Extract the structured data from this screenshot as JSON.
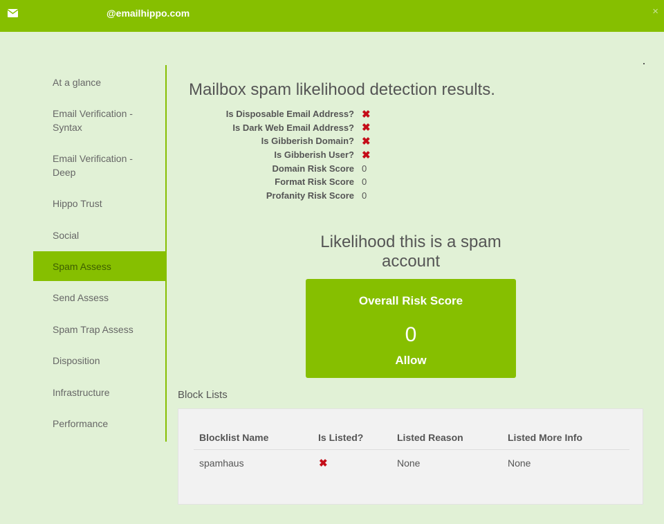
{
  "header": {
    "email": "@emailhippo.com",
    "mail_icon": "envelope-icon",
    "close_label": "×",
    "bg_color": "#86bf00"
  },
  "sidebar": {
    "items": [
      {
        "label": "At a glance",
        "active": false
      },
      {
        "label": "Email Verification - Syntax",
        "active": false
      },
      {
        "label": "Email Verification - Deep",
        "active": false
      },
      {
        "label": "Hippo Trust",
        "active": false
      },
      {
        "label": "Social",
        "active": false
      },
      {
        "label": "Spam Assess",
        "active": true
      },
      {
        "label": "Send Assess",
        "active": false
      },
      {
        "label": "Spam Trap Assess",
        "active": false
      },
      {
        "label": "Disposition",
        "active": false
      },
      {
        "label": "Infrastructure",
        "active": false
      },
      {
        "label": "Performance",
        "active": false
      }
    ]
  },
  "main": {
    "title": "Mailbox spam likelihood detection results.",
    "flags": [
      {
        "label": "Is Disposable Email Address?",
        "value": "✖",
        "icon": "red-x-icon"
      },
      {
        "label": "Is Dark Web Email Address?",
        "value": "✖",
        "icon": "red-x-icon"
      },
      {
        "label": "Is Gibberish Domain?",
        "value": "✖",
        "icon": "red-x-icon"
      },
      {
        "label": "Is Gibberish User?",
        "value": "✖",
        "icon": "red-x-icon"
      },
      {
        "label": "Domain Risk Score",
        "value": "0"
      },
      {
        "label": "Format Risk Score",
        "value": "0"
      },
      {
        "label": "Profanity Risk Score",
        "value": "0"
      }
    ],
    "likelihood_heading": "Likelihood this is a spam account",
    "risk": {
      "title": "Overall Risk Score",
      "score": "0",
      "verdict": "Allow"
    }
  },
  "blocklists": {
    "heading": "Block Lists",
    "columns": [
      "Blocklist Name",
      "Is Listed?",
      "Listed Reason",
      "Listed More Info"
    ],
    "rows": [
      {
        "name": "spamhaus",
        "listed": "✖",
        "listed_icon": "red-x-icon",
        "reason": "None",
        "more_info": "None"
      }
    ]
  },
  "colors": {
    "accent": "#86bf00",
    "background": "#e1f1d6",
    "error": "#c40d18"
  }
}
